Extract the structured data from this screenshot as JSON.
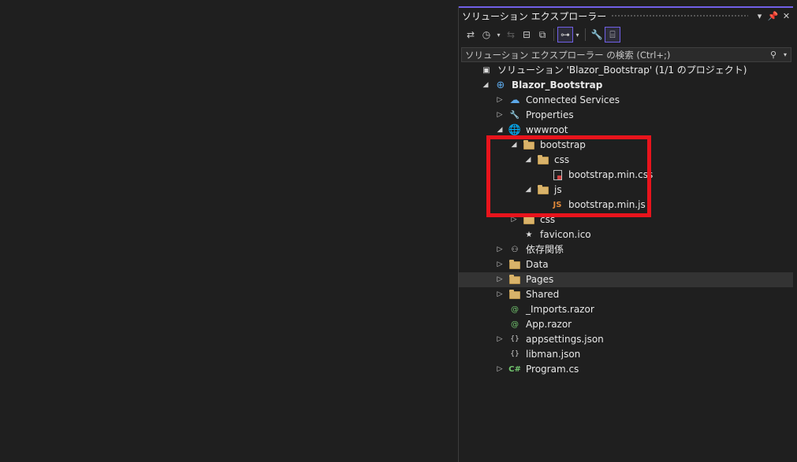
{
  "panel": {
    "title": "ソリューション エクスプローラー",
    "search_placeholder": "ソリューション エクスプローラー の検索 (Ctrl+;)"
  },
  "titlebar_buttons": [
    {
      "name": "dropdown-arrow-icon",
      "glyph": "▾"
    },
    {
      "name": "pin-icon",
      "glyph": "📌"
    },
    {
      "name": "close-icon",
      "glyph": "✕"
    }
  ],
  "toolbar": [
    {
      "name": "switch-views-icon",
      "glyph": "⇄"
    },
    {
      "name": "history-icon",
      "glyph": "◷"
    },
    {
      "name": "history-dropdown-icon",
      "glyph": "▾",
      "small": true
    },
    {
      "name": "sync-icon",
      "glyph": "⇆",
      "dim": true
    },
    {
      "name": "collapse-all-icon",
      "glyph": "⊟"
    },
    {
      "name": "show-all-files-icon",
      "glyph": "⧉"
    },
    {
      "sep": true
    },
    {
      "name": "filter-icon",
      "glyph": "⊶",
      "active": true
    },
    {
      "name": "filter-dropdown-icon",
      "glyph": "▾",
      "small": true
    },
    {
      "sep": true
    },
    {
      "name": "properties-icon",
      "glyph": "🔧"
    },
    {
      "name": "preview-icon",
      "glyph": "⌸",
      "active": true
    }
  ],
  "tree": [
    {
      "label": "ソリューション 'Blazor_Bootstrap' (1/1 のプロジェクト)",
      "indent": 0,
      "expander": "",
      "icon": "solution",
      "bold": false
    },
    {
      "label": "Blazor_Bootstrap",
      "indent": 1,
      "expander": "◢",
      "icon": "project",
      "bold": true
    },
    {
      "label": "Connected Services",
      "indent": 2,
      "expander": "▷",
      "icon": "connected",
      "bold": false
    },
    {
      "label": "Properties",
      "indent": 2,
      "expander": "▷",
      "icon": "properties",
      "bold": false
    },
    {
      "label": "wwwroot",
      "indent": 2,
      "expander": "◢",
      "icon": "globe",
      "bold": false
    },
    {
      "label": "bootstrap",
      "indent": 3,
      "expander": "◢",
      "icon": "folder",
      "bold": false
    },
    {
      "label": "css",
      "indent": 4,
      "expander": "◢",
      "icon": "folder",
      "bold": false
    },
    {
      "label": "bootstrap.min.css",
      "indent": 5,
      "expander": "",
      "icon": "cssfile",
      "bold": false
    },
    {
      "label": "js",
      "indent": 4,
      "expander": "◢",
      "icon": "folder",
      "bold": false
    },
    {
      "label": "bootstrap.min.js",
      "indent": 5,
      "expander": "",
      "icon": "jsfile",
      "bold": false
    },
    {
      "label": "css",
      "indent": 3,
      "expander": "▷",
      "icon": "folder",
      "bold": false
    },
    {
      "label": "favicon.ico",
      "indent": 3,
      "expander": "",
      "icon": "icofile",
      "bold": false
    },
    {
      "label": "依存関係",
      "indent": 2,
      "expander": "▷",
      "icon": "deps",
      "bold": false
    },
    {
      "label": "Data",
      "indent": 2,
      "expander": "▷",
      "icon": "folder",
      "bold": false
    },
    {
      "label": "Pages",
      "indent": 2,
      "expander": "▷",
      "icon": "folder",
      "bold": false,
      "selected": true
    },
    {
      "label": "Shared",
      "indent": 2,
      "expander": "▷",
      "icon": "folder",
      "bold": false
    },
    {
      "label": "_Imports.razor",
      "indent": 2,
      "expander": "",
      "icon": "razor",
      "bold": false
    },
    {
      "label": "App.razor",
      "indent": 2,
      "expander": "",
      "icon": "razor",
      "bold": false
    },
    {
      "label": "appsettings.json",
      "indent": 2,
      "expander": "▷",
      "icon": "json",
      "bold": false
    },
    {
      "label": "libman.json",
      "indent": 2,
      "expander": "",
      "icon": "json",
      "bold": false
    },
    {
      "label": "Program.cs",
      "indent": 2,
      "expander": "▷",
      "icon": "csharp",
      "bold": false
    }
  ],
  "icon_glyphs": {
    "solution": "▣",
    "project": "⊕",
    "connected": "☁",
    "properties": "🔧",
    "globe": "🌐",
    "deps": "⚇",
    "cssfile": "",
    "jsfile": "JS",
    "icofile": "★",
    "razor": "@",
    "json": "{}",
    "csharp": "C#"
  }
}
